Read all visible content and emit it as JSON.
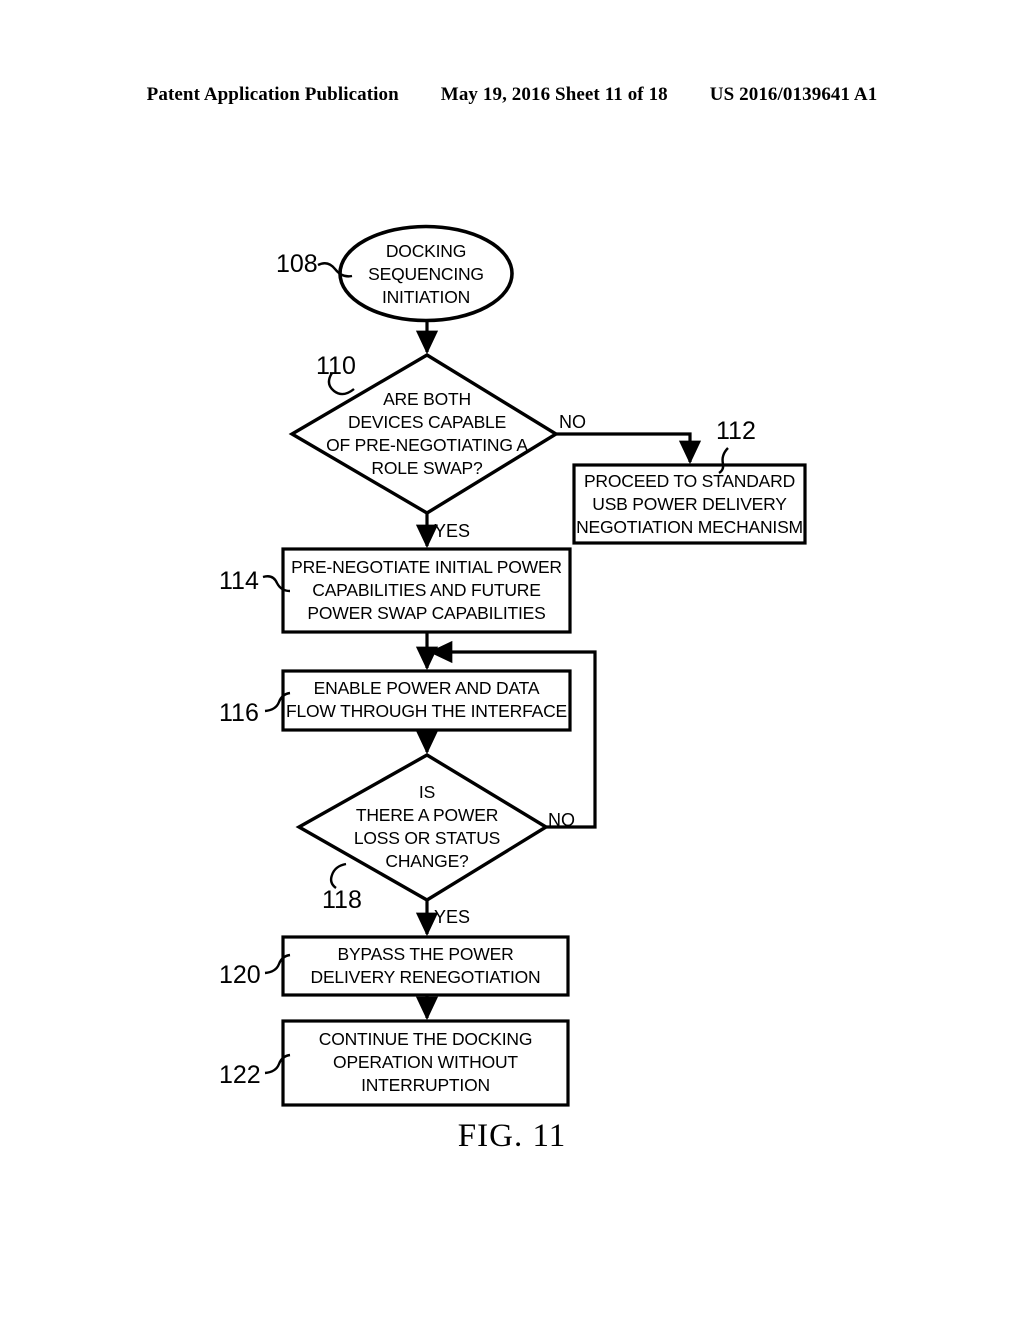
{
  "header": {
    "left": "Patent Application Publication",
    "middle": "May 19, 2016  Sheet 11 of 18",
    "right": "US 2016/0139641 A1"
  },
  "figure": {
    "caption": "FIG. 11",
    "nodes": {
      "n108": {
        "ref": "108",
        "shape": "oval",
        "text": "DOCKING\nSEQUENCING\nINITIATION"
      },
      "n110": {
        "ref": "110",
        "shape": "diamond",
        "text": "ARE BOTH\nDEVICES CAPABLE\nOF PRE-NEGOTIATING A\nROLE SWAP?"
      },
      "n112": {
        "ref": "112",
        "shape": "rect",
        "text": "PROCEED TO STANDARD\nUSB POWER DELIVERY\nNEGOTIATION MECHANISM"
      },
      "n114": {
        "ref": "114",
        "shape": "rect",
        "text": "PRE-NEGOTIATE INITIAL POWER\nCAPABILITIES AND FUTURE\nPOWER SWAP CAPABILITIES"
      },
      "n116": {
        "ref": "116",
        "shape": "rect",
        "text": "ENABLE POWER AND DATA\nFLOW THROUGH THE INTERFACE"
      },
      "n118": {
        "ref": "118",
        "shape": "diamond",
        "text": "IS\nTHERE A POWER\nLOSS OR STATUS\nCHANGE?"
      },
      "n120": {
        "ref": "120",
        "shape": "rect",
        "text": "BYPASS THE POWER\nDELIVERY RENEGOTIATION"
      },
      "n122": {
        "ref": "122",
        "shape": "rect",
        "text": "CONTINUE THE DOCKING\nOPERATION WITHOUT\nINTERRUPTION"
      }
    },
    "branches": {
      "b110_no": "NO",
      "b110_yes": "YES",
      "b118_no": "NO",
      "b118_yes": "YES"
    },
    "colors": {
      "stroke": "#000000",
      "fill": "#ffffff",
      "background": "#ffffff"
    }
  }
}
